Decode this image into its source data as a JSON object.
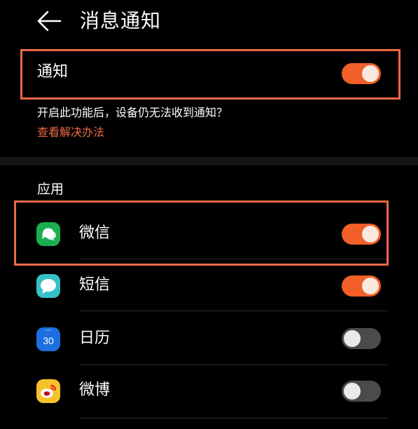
{
  "header": {
    "title": "消息通知",
    "back_icon": "arrow-left-icon"
  },
  "notifications": {
    "label": "通知",
    "enabled": true
  },
  "hint": {
    "text": "开启此功能后，设备仍无法收到通知？",
    "link": "查看解决办法"
  },
  "apps_section": {
    "title": "应用",
    "items": [
      {
        "label": "微信",
        "icon": "wechat-icon",
        "enabled": true
      },
      {
        "label": "短信",
        "icon": "messages-icon",
        "enabled": true
      },
      {
        "label": "日历",
        "icon": "calendar-icon",
        "icon_text": "30",
        "enabled": false
      },
      {
        "label": "微博",
        "icon": "weibo-icon",
        "enabled": false
      }
    ]
  },
  "colors": {
    "background": "#000000",
    "accent": "#f25f28",
    "highlight": "#ec6a45",
    "toggle_off": "#4b4b4b"
  }
}
